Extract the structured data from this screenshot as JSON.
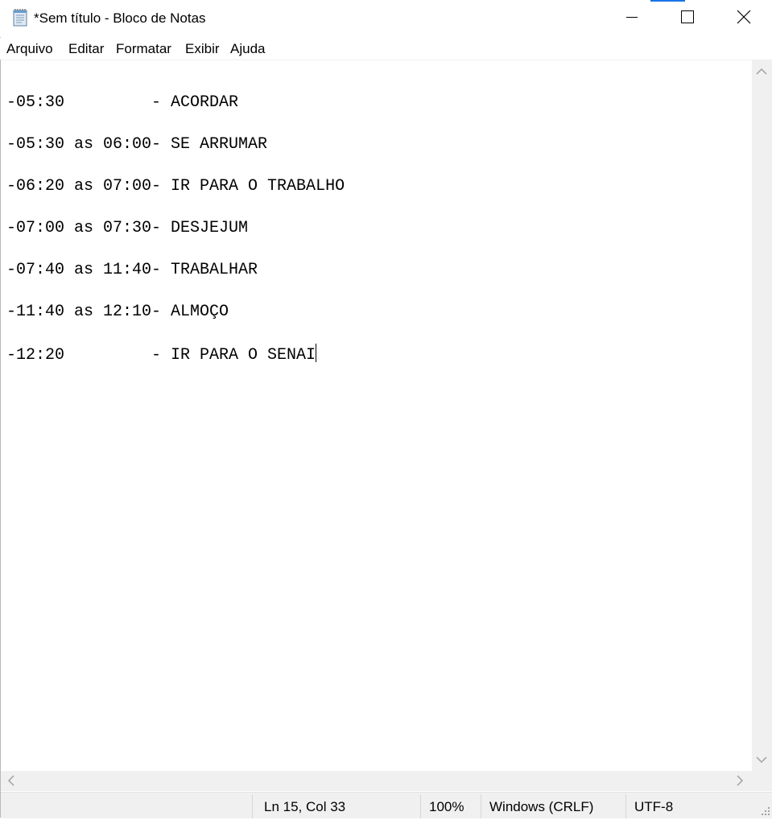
{
  "window": {
    "title": "*Sem título - Bloco de Notas",
    "app_icon": "notepad-icon",
    "controls": [
      "minimize-icon",
      "maximize-icon",
      "close-icon"
    ],
    "accent_color": "#1a73e8"
  },
  "menu": {
    "items": [
      {
        "label": "Arquivo"
      },
      {
        "label": "Editar"
      },
      {
        "label": "Formatar"
      },
      {
        "label": "Exibir"
      },
      {
        "label": "Ajuda"
      }
    ]
  },
  "editor": {
    "lines": [
      "",
      "-05:30         - ACORDAR",
      "",
      "-05:30 as 06:00- SE ARRUMAR",
      "",
      "-06:20 as 07:00- IR PARA O TRABALHO",
      "",
      "-07:00 as 07:30- DESJEJUM",
      "",
      "-07:40 as 11:40- TRABALHAR",
      "",
      "-11:40 as 12:10- ALMOÇO",
      "",
      "-12:20         - IR PARA O SENAI"
    ]
  },
  "status": {
    "position": "Ln 15, Col 33",
    "zoom": "100%",
    "line_ending": "Windows (CRLF)",
    "encoding": "UTF-8"
  }
}
